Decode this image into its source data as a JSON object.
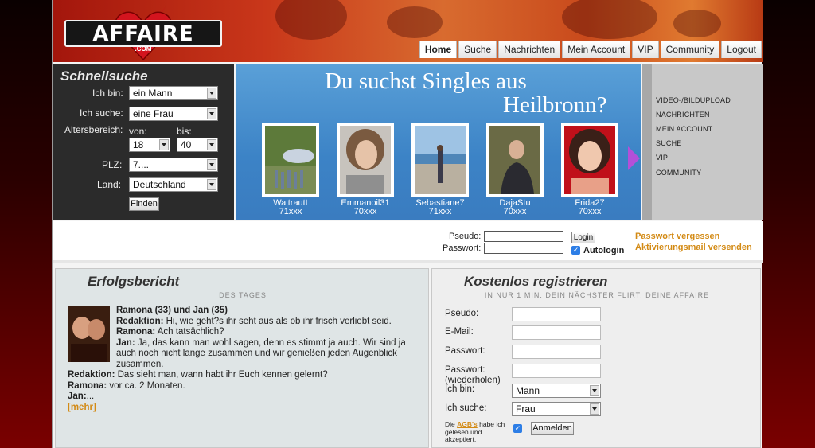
{
  "logo": {
    "text": "AFFAIRE",
    "sub": ".COM"
  },
  "nav": [
    "Home",
    "Suche",
    "Nachrichten",
    "Mein Account",
    "VIP",
    "Community",
    "Logout"
  ],
  "quicksearch": {
    "title": "Schnellsuche",
    "i_am_label": "Ich bin:",
    "i_am_value": "ein Mann",
    "looking_label": "Ich suche:",
    "looking_value": "eine Frau",
    "age_label": "Altersbereich:",
    "from_label": "von:",
    "to_label": "bis:",
    "age_from": "18",
    "age_to": "40",
    "zip_label": "PLZ:",
    "zip_value": "7....",
    "country_label": "Land:",
    "country_value": "Deutschland",
    "find_button": "Finden"
  },
  "banner": {
    "line1": "Du suchst Singles aus",
    "line2": "Heilbronn?",
    "profiles": [
      {
        "name": "Waltrautt",
        "zip": "71xxx"
      },
      {
        "name": "Emmanoil31",
        "zip": "70xxx"
      },
      {
        "name": "Sebastiane7",
        "zip": "71xxx"
      },
      {
        "name": "DajaStu",
        "zip": "70xxx"
      },
      {
        "name": "Frida27",
        "zip": "70xxx"
      }
    ]
  },
  "side_links": [
    "VIDEO-/BILDUPLOAD",
    "NACHRICHTEN",
    "MEIN ACCOUNT",
    "SUCHE",
    "VIP",
    "COMMUNITY"
  ],
  "login": {
    "pseudo_label": "Pseudo:",
    "password_label": "Passwort:",
    "login_button": "Login",
    "autologin_label": "Autologin",
    "forgot_link": "Passwort vergessen",
    "activation_link": "Aktivierungsmail versenden"
  },
  "story": {
    "title": "Erfolgsbericht",
    "subtitle": "DES TAGES",
    "heading": "Ramona (33) und Jan (35)",
    "l1_who": "Redaktion:",
    "l1_text": "Hi, wie geht?s ihr seht aus als ob ihr frisch verliebt seid.",
    "l2_who": "Ramona:",
    "l2_text": "Ach tatsächlich?",
    "l3_who": "Jan:",
    "l3_text": "Ja, das kann man wohl sagen, denn es stimmt ja auch. Wir sind ja",
    "l3b": "auch noch nicht lange zusammen und wir genießen jeden Augenblick",
    "l3c": "zusammen.",
    "l4_who": "Redaktion:",
    "l4_text": "Das sieht man, wann habt ihr Euch kennen gelernt?",
    "l5_who": "Ramona:",
    "l5_text": "vor ca. 2 Monaten.",
    "l6_who": "Jan:",
    "l6_text": "...",
    "more": "[mehr]"
  },
  "register": {
    "title": "Kostenlos registrieren",
    "subtitle": "IN NUR 1 MIN. DEIN NÄCHSTER FLIRT, DEINE AFFAIRE",
    "pseudo_label": "Pseudo:",
    "email_label": "E-Mail:",
    "password_label": "Passwort:",
    "password2_label": "Passwort:",
    "password2_sub": "(wiederholen)",
    "i_am_label": "Ich bin:",
    "i_am_value": "Mann",
    "looking_label": "Ich suche:",
    "looking_value": "Frau",
    "agb_pre": "Die ",
    "agb_link": "AGB's",
    "agb_post": " habe ich",
    "agb_line2": "gelesen und",
    "agb_line3": "akzeptiert.",
    "submit": "Anmelden"
  }
}
